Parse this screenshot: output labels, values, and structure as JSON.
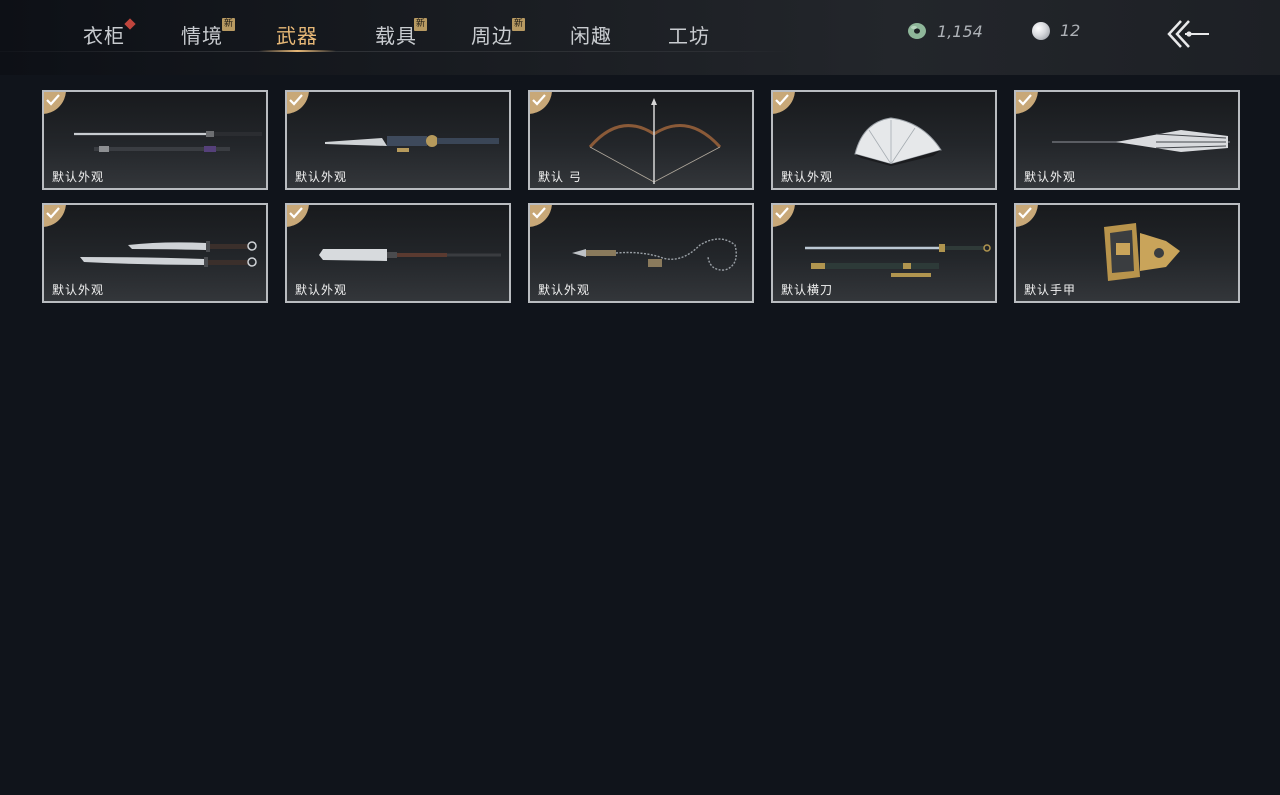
{
  "header": {
    "tabs": [
      {
        "label": "衣柜",
        "active": false,
        "badge": "dot"
      },
      {
        "label": "情境",
        "active": false,
        "badge": "新"
      },
      {
        "label": "武器",
        "active": true,
        "badge": ""
      },
      {
        "label": "载具",
        "active": false,
        "badge": "新"
      },
      {
        "label": "周边",
        "active": false,
        "badge": "新"
      },
      {
        "label": "闲趣",
        "active": false,
        "badge": ""
      },
      {
        "label": "工坊",
        "active": false,
        "badge": ""
      }
    ],
    "currencies": [
      {
        "icon": "jade-coin-icon",
        "value": "1,154"
      },
      {
        "icon": "pearl-icon",
        "value": "12"
      }
    ],
    "back_icon": "back-arrow-icon"
  },
  "items": [
    {
      "label": "默认外观",
      "weapon": "twin-swords",
      "equipped": true
    },
    {
      "label": "默认外观",
      "weapon": "ornate-sword",
      "equipped": true
    },
    {
      "label": "默认 弓",
      "weapon": "bow",
      "equipped": true
    },
    {
      "label": "默认外观",
      "weapon": "fan",
      "equipped": true
    },
    {
      "label": "默认外观",
      "weapon": "umbrella",
      "equipped": true
    },
    {
      "label": "默认外观",
      "weapon": "twin-blades",
      "equipped": true
    },
    {
      "label": "默认外观",
      "weapon": "glaive",
      "equipped": true
    },
    {
      "label": "默认外观",
      "weapon": "rope-dart",
      "equipped": true
    },
    {
      "label": "默认横刀",
      "weapon": "hengdao",
      "equipped": true
    },
    {
      "label": "默认手甲",
      "weapon": "gauntlet",
      "equipped": true
    }
  ],
  "colors": {
    "accent": "#e7b877",
    "background": "#10141b",
    "check_badge": "#c8a878",
    "new_badge": "#b89a62",
    "red_dot": "#c0453d"
  }
}
